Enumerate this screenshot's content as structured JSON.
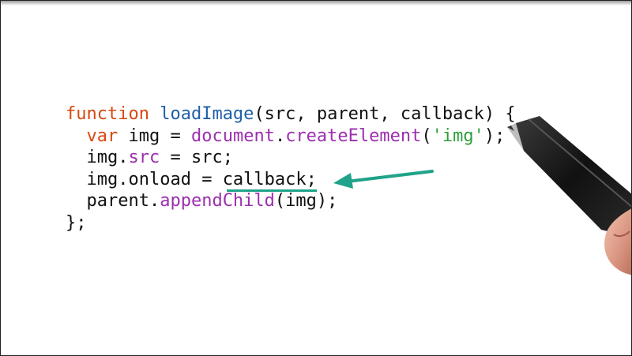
{
  "code": {
    "lines": [
      {
        "indent": "",
        "tokens": [
          {
            "t": "function",
            "c": "kw"
          },
          {
            "t": " ",
            "c": "pl"
          },
          {
            "t": "loadImage",
            "c": "fn"
          },
          {
            "t": "(src, parent, callback) {",
            "c": "pl"
          }
        ]
      },
      {
        "indent": "  ",
        "tokens": [
          {
            "t": "var",
            "c": "kw"
          },
          {
            "t": " img = ",
            "c": "pl"
          },
          {
            "t": "document",
            "c": "mem"
          },
          {
            "t": ".",
            "c": "pl"
          },
          {
            "t": "createElement",
            "c": "mem"
          },
          {
            "t": "(",
            "c": "pl"
          },
          {
            "t": "'img'",
            "c": "str"
          },
          {
            "t": ");",
            "c": "pl"
          }
        ]
      },
      {
        "indent": "  ",
        "tokens": [
          {
            "t": "img.",
            "c": "pl"
          },
          {
            "t": "src",
            "c": "mem"
          },
          {
            "t": " = src;",
            "c": "pl"
          }
        ]
      },
      {
        "indent": "  ",
        "tokens": [
          {
            "t": "img.onload = ",
            "c": "pl"
          },
          {
            "t": "callback",
            "c": "pl"
          },
          {
            "t": ";",
            "c": "pl"
          }
        ]
      },
      {
        "indent": "  ",
        "tokens": [
          {
            "t": "parent.",
            "c": "pl"
          },
          {
            "t": "appendChild",
            "c": "mem"
          },
          {
            "t": "(img);",
            "c": "pl"
          }
        ]
      },
      {
        "indent": "",
        "tokens": [
          {
            "t": "};",
            "c": "pl"
          }
        ]
      }
    ]
  },
  "annotation": {
    "highlight_color": "#1fa38a",
    "highlighted_token": "callback",
    "icon": "arrow-left-icon"
  },
  "colors": {
    "keyword": "#d9480f",
    "function_name": "#1f5fa8",
    "member": "#9b2fae",
    "string": "#2e9e3a",
    "plain": "#111111"
  }
}
